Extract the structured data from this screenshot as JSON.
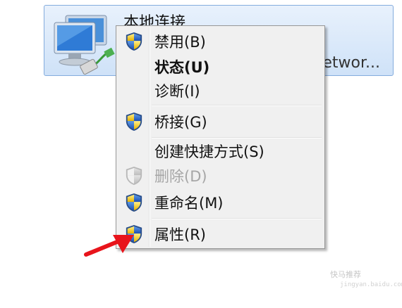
{
  "adapter": {
    "name": "本地连接",
    "device_text": "etwor..."
  },
  "context_menu": {
    "items": [
      {
        "label": "禁用(B)",
        "icon": "uac-shield-icon"
      },
      {
        "label": "状态(U)",
        "default": true
      },
      {
        "label": "诊断(I)"
      },
      {
        "label": "桥接(G)",
        "icon": "uac-shield-icon"
      },
      {
        "label": "创建快捷方式(S)"
      },
      {
        "label": "删除(D)",
        "icon": "uac-shield-icon",
        "disabled": true
      },
      {
        "label": "重命名(M)",
        "icon": "uac-shield-icon"
      },
      {
        "label": "属性(R)",
        "icon": "uac-shield-icon"
      }
    ]
  },
  "annotation": {
    "color": "#e8141b"
  },
  "watermark": {
    "text": "快马推荐",
    "sub": "jingyan.baidu.com"
  }
}
